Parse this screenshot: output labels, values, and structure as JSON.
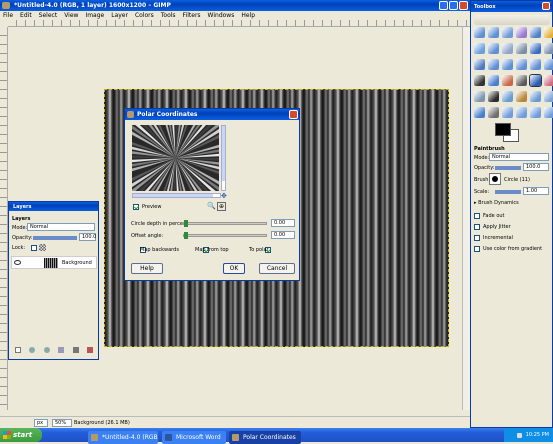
{
  "main_window": {
    "title": "*Untitled-4.0 (RGB, 1 layer) 1600x1200 – GIMP",
    "menu": [
      "File",
      "Edit",
      "Select",
      "View",
      "Image",
      "Layer",
      "Colors",
      "Tools",
      "Filters",
      "Windows",
      "Help"
    ],
    "status": {
      "unit": "px",
      "zoom": "50%",
      "layer_info": "Background (26.1 MB)"
    }
  },
  "toolbox": {
    "title": "Toolbox",
    "options_title": "Paintbrush",
    "mode_label": "Mode:",
    "mode_value": "Normal",
    "opacity_label": "Opacity:",
    "opacity_value": "100.0",
    "brush_label": "Brush:",
    "brush_value": "Circle (11)",
    "scale_label": "Scale:",
    "scale_value": "1.00",
    "brush_dynamics_label": "Brush Dynamics",
    "options": [
      {
        "label": "Fade out",
        "checked": false
      },
      {
        "label": "Apply Jitter",
        "checked": false
      },
      {
        "label": "Incremental",
        "checked": false
      },
      {
        "label": "Use color from gradient",
        "checked": false
      }
    ]
  },
  "layers": {
    "title": "Layers",
    "header": "Layers",
    "mode_label": "Mode:",
    "mode_value": "Normal",
    "opacity_label": "Opacity:",
    "opacity_value": "100.0",
    "lock_label": "Lock:",
    "layer_name": "Background"
  },
  "dialog": {
    "title": "Polar Coordinates",
    "preview_label": "Preview",
    "preview_checked": true,
    "circle_depth_label": "Circle depth in percent:",
    "circle_depth_value": "0.00",
    "circle_depth_level": 0.0,
    "offset_angle_label": "Offset angle:",
    "offset_angle_value": "0.00",
    "offset_angle_level": 0.0,
    "map_backwards_label": "Map backwards",
    "map_backwards_checked": false,
    "map_from_top_label": "Map from top",
    "map_from_top_checked": true,
    "to_polar_label": "To polar",
    "to_polar_checked": true,
    "help_label": "Help",
    "ok_label": "OK",
    "cancel_label": "Cancel"
  },
  "taskbar": {
    "start_label": "start",
    "items": [
      "*Untitled-4.0 (RGB, 1...",
      "Microsoft Word",
      "Polar Coordinates"
    ],
    "clock": "10:25 PM"
  },
  "colors": {
    "xp_blue": "#0a5fe0",
    "taskbar": "#245edb",
    "start_green": "#3c9a3c",
    "canvas_bg": "#ece9d8"
  }
}
